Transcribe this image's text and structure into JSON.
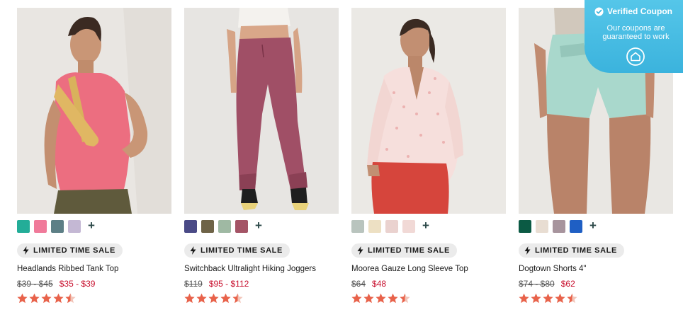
{
  "products": [
    {
      "name": "Headlands Ribbed Tank Top",
      "badge": "LIMITED TIME SALE",
      "old_price": "$39 - $45",
      "sale_price": "$35 - $39",
      "rating": 4.5,
      "swatches": [
        "#23ad98",
        "#f07a9a",
        "#5d7f86",
        "#c4b8d4"
      ]
    },
    {
      "name": "Switchback Ultralight Hiking Joggers",
      "badge": "LIMITED TIME SALE",
      "old_price": "$119",
      "sale_price": "$95 - $112",
      "rating": 4.5,
      "swatches": [
        "#4a4a86",
        "#6e6347",
        "#9fb9a3",
        "#a45466"
      ]
    },
    {
      "name": "Moorea Gauze Long Sleeve Top",
      "badge": "LIMITED TIME SALE",
      "old_price": "$64",
      "sale_price": "$48",
      "rating": 4.5,
      "swatches": [
        "#b9c4be",
        "#ede0c3",
        "#ead2cf",
        "#f1d9d6"
      ]
    },
    {
      "name": "Dogtown Shorts 4\"",
      "badge": "LIMITED TIME SALE",
      "old_price": "$74 - $80",
      "sale_price": "$62",
      "rating": 4.5,
      "swatches": [
        "#0b5a44",
        "#e8ddd2",
        "#a7949d",
        "#1f5fc4"
      ]
    }
  ],
  "more_colors_label": "+",
  "coupon": {
    "title": "Verified Coupon",
    "text": "Our coupons are guaranteed to work"
  },
  "colors": {
    "sale_red": "#c8102e",
    "star": "#e8624a",
    "badge_bg": "#ebebeb",
    "coupon_bg": "#47bce3"
  },
  "icons": [
    "lightning-bolt-icon",
    "star-icon",
    "check-circle-icon",
    "house-logo-icon",
    "plus-icon"
  ]
}
